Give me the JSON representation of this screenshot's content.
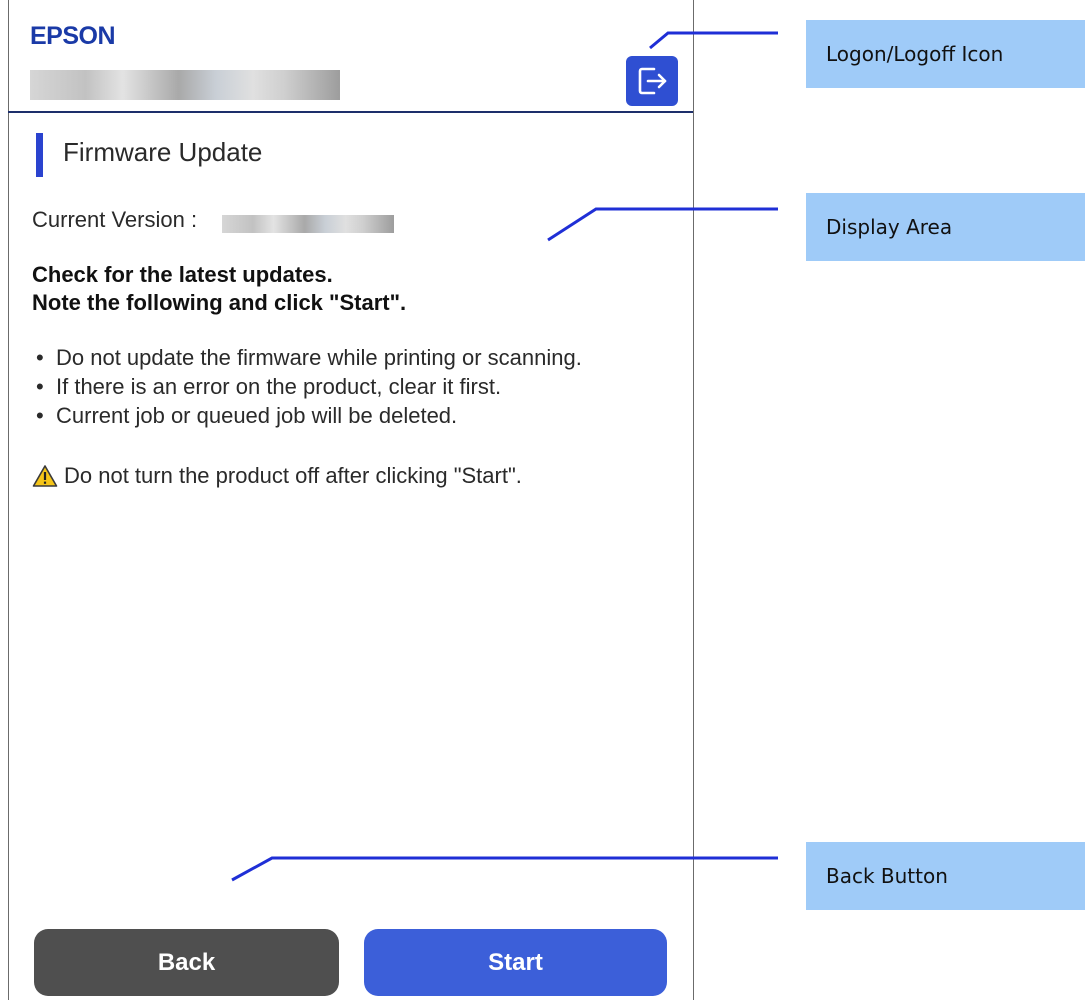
{
  "header": {
    "brand": "EPSON",
    "logoff_icon": "logoff-icon"
  },
  "main": {
    "title": "Firmware Update",
    "current_version_label": "Current Version :",
    "instruction_line1": "Check for the latest updates.",
    "instruction_line2": "Note the following and click \"Start\".",
    "notes": [
      "Do not update the firmware while printing or scanning.",
      "If there is an error on the product, clear it first.",
      "Current job or queued job will be deleted."
    ],
    "warning_icon": "warning-icon",
    "warning_text": "Do not turn the product off after clicking \"Start\"."
  },
  "footer": {
    "back_label": "Back",
    "start_label": "Start"
  },
  "callouts": {
    "logoff": "Logon/Logoff Icon",
    "display_area": "Display Area",
    "back_button": "Back Button"
  },
  "colors": {
    "brand": "#1a3aa7",
    "accent": "#2f4fd2",
    "start_button": "#3c5fd9",
    "back_button": "#4f4f4f",
    "callout_bg": "#9fcbf8",
    "leader_line": "#1f2fd6"
  }
}
